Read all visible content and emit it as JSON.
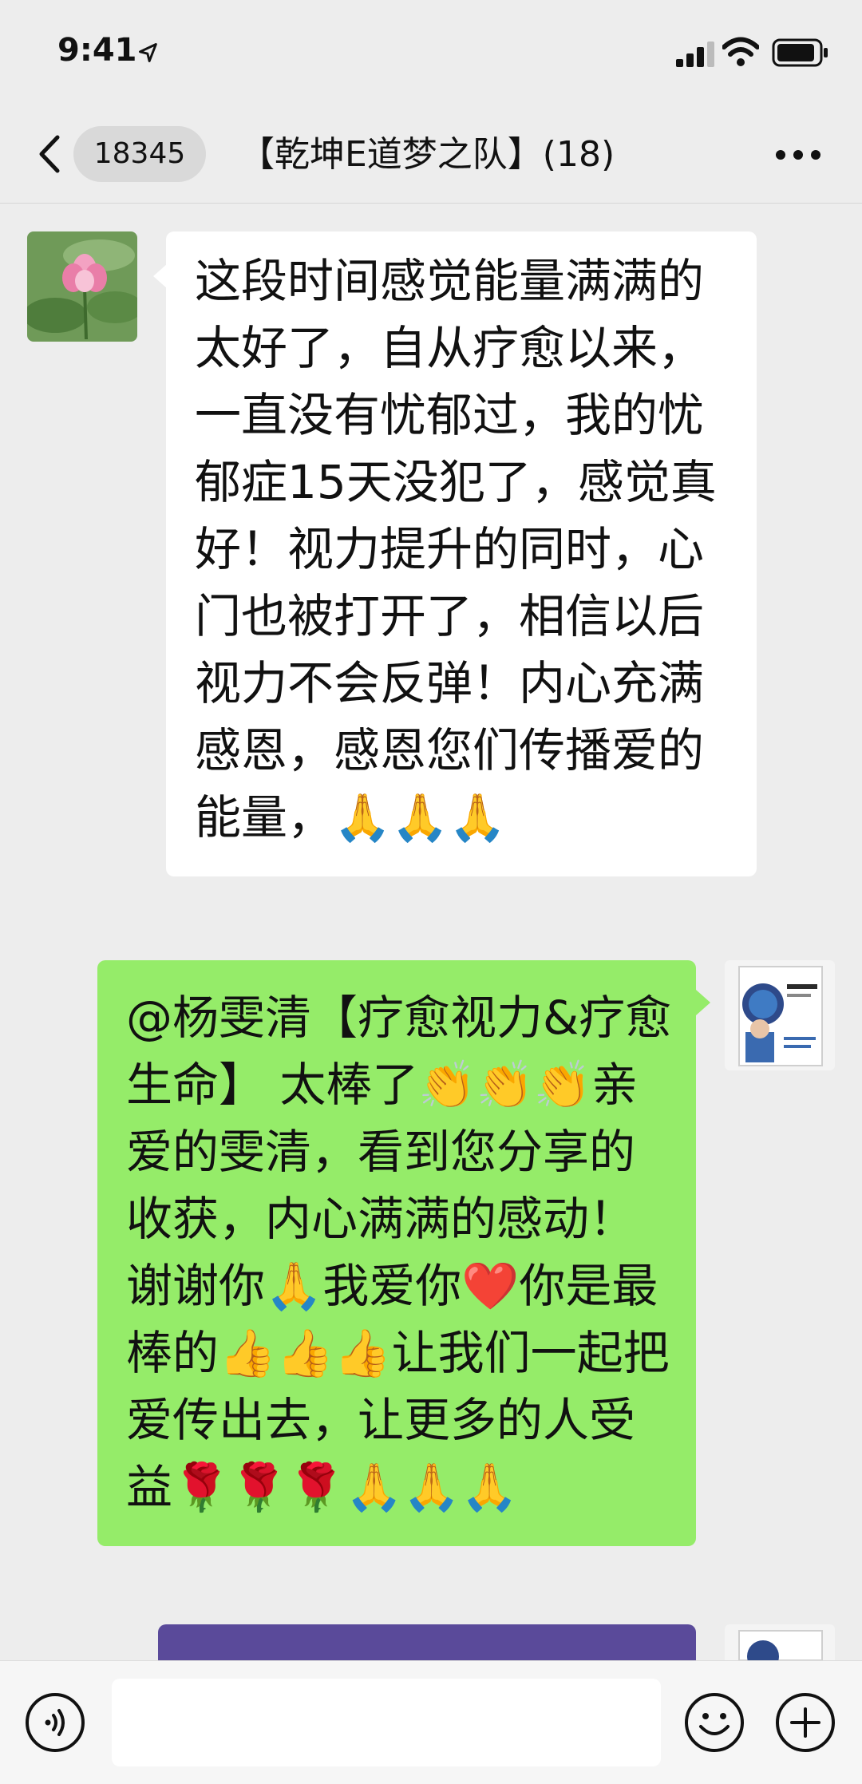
{
  "status_bar": {
    "time": "9:41",
    "icons": [
      "location-arrow-icon",
      "signal-icon",
      "wifi-icon",
      "battery-icon"
    ]
  },
  "nav": {
    "back_icon": "chevron-left-icon",
    "unread_count": "18345",
    "title": "【乾坤E道梦之队】(18)",
    "more_icon": "more-dots-icon"
  },
  "messages": [
    {
      "side": "left",
      "avatar": "lotus-avatar",
      "text": "这段时间感觉能量满满的太好了，自从疗愈以来，一直没有忧郁过，我的忧郁症15天没犯了，感觉真好！视力提升的同时，心门也被打开了，相信以后视力不会反弹！内心充满感恩，感恩您们传播爱的能量，🙏🙏🙏"
    },
    {
      "side": "right",
      "avatar": "book-cover-avatar",
      "text": "@杨雯清【疗愈视力&疗愈生命】 太棒了👏👏👏亲爱的雯清，看到您分享的收获，内心满满的感动！谢谢你🙏我爱你❤️你是最棒的👍👍👍让我们一起把爱传出去，让更多的人受益🌹🌹🌹🙏🙏🙏"
    }
  ],
  "input_bar": {
    "voice_icon": "voice-icon",
    "placeholder": "",
    "emoji_icon": "emoji-icon",
    "plus_icon": "plus-icon"
  },
  "colors": {
    "background": "#ededed",
    "bubble_self": "#95ec69",
    "bubble_other": "#ffffff"
  }
}
